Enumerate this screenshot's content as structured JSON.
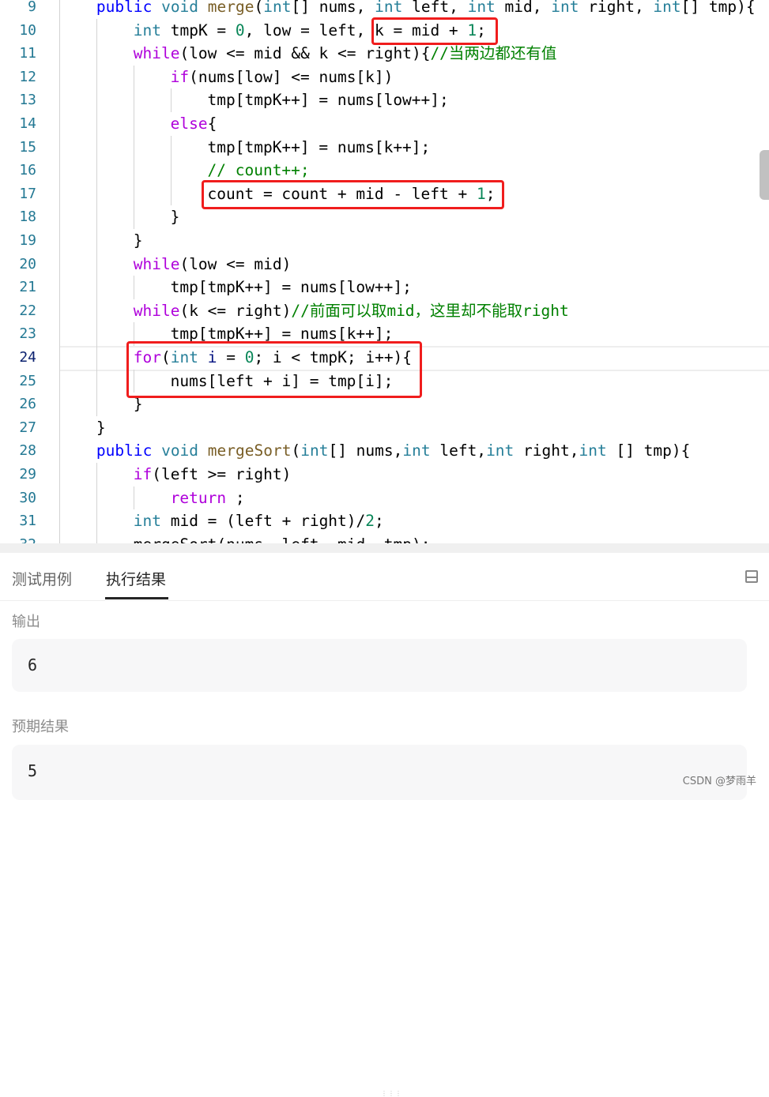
{
  "editor": {
    "active_line": 24,
    "lines": [
      {
        "n": "9",
        "indent": 1,
        "tokens": [
          [
            "public",
            "kw"
          ],
          [
            " ",
            ""
          ],
          [
            "void",
            "ty"
          ],
          [
            " ",
            ""
          ],
          [
            "merge",
            "fn"
          ],
          [
            "(",
            ""
          ],
          [
            "int",
            "ty"
          ],
          [
            "[] nums, ",
            ""
          ],
          [
            "int",
            "ty"
          ],
          [
            " left, ",
            ""
          ],
          [
            "int",
            "ty"
          ],
          [
            " mid, ",
            ""
          ],
          [
            "int",
            "ty"
          ],
          [
            " right, ",
            ""
          ],
          [
            "int",
            "ty"
          ],
          [
            "[] tmp){",
            ""
          ]
        ]
      },
      {
        "n": "10",
        "indent": 2,
        "tokens": [
          [
            "int",
            "ty"
          ],
          [
            " tmpK = ",
            ""
          ],
          [
            "0",
            "num"
          ],
          [
            ", low = left, k = mid + ",
            ""
          ],
          [
            "1",
            "num"
          ],
          [
            ";",
            ""
          ]
        ]
      },
      {
        "n": "11",
        "indent": 2,
        "tokens": [
          [
            "while",
            "ctl"
          ],
          [
            "(low <= mid && k <= right){",
            ""
          ],
          [
            "//当两边都还有值",
            "cm"
          ]
        ]
      },
      {
        "n": "12",
        "indent": 3,
        "tokens": [
          [
            "if",
            "ctl"
          ],
          [
            "(nums[low] <= nums[k])",
            ""
          ]
        ]
      },
      {
        "n": "13",
        "indent": 4,
        "tokens": [
          [
            "tmp[tmpK++] = nums[low++];",
            ""
          ]
        ]
      },
      {
        "n": "14",
        "indent": 3,
        "tokens": [
          [
            "else",
            "ctl"
          ],
          [
            "{",
            ""
          ]
        ]
      },
      {
        "n": "15",
        "indent": 4,
        "tokens": [
          [
            "tmp[tmpK++] = nums[k++];",
            ""
          ]
        ]
      },
      {
        "n": "16",
        "indent": 4,
        "tokens": [
          [
            "// count++;",
            "cm"
          ]
        ]
      },
      {
        "n": "17",
        "indent": 4,
        "tokens": [
          [
            "count = count + mid - left + ",
            ""
          ],
          [
            "1",
            "num"
          ],
          [
            ";",
            ""
          ]
        ]
      },
      {
        "n": "18",
        "indent": 3,
        "tokens": [
          [
            "}",
            ""
          ]
        ]
      },
      {
        "n": "19",
        "indent": 2,
        "tokens": [
          [
            "}",
            ""
          ]
        ]
      },
      {
        "n": "20",
        "indent": 2,
        "tokens": [
          [
            "while",
            "ctl"
          ],
          [
            "(low <= mid)",
            ""
          ]
        ]
      },
      {
        "n": "21",
        "indent": 3,
        "tokens": [
          [
            "tmp[tmpK++] = nums[low++];",
            ""
          ]
        ]
      },
      {
        "n": "22",
        "indent": 2,
        "tokens": [
          [
            "while",
            "ctl"
          ],
          [
            "(k <= right)",
            ""
          ],
          [
            "//前面可以取mid，这里却不能取right",
            "cm"
          ]
        ]
      },
      {
        "n": "23",
        "indent": 3,
        "tokens": [
          [
            "tmp[tmpK++] = nums[k++];",
            ""
          ]
        ]
      },
      {
        "n": "24",
        "indent": 2,
        "tokens": [
          [
            "for",
            "ctl"
          ],
          [
            "(",
            ""
          ],
          [
            "int",
            "ty"
          ],
          [
            " ",
            ""
          ],
          [
            "i",
            "var"
          ],
          [
            " = ",
            ""
          ],
          [
            "0",
            "num"
          ],
          [
            "; i < tmpK; i++){",
            ""
          ]
        ]
      },
      {
        "n": "25",
        "indent": 3,
        "tokens": [
          [
            "nums[left + i] = tmp[i];",
            ""
          ]
        ]
      },
      {
        "n": "26",
        "indent": 2,
        "tokens": [
          [
            "}",
            ""
          ]
        ]
      },
      {
        "n": "27",
        "indent": 1,
        "tokens": [
          [
            "}",
            ""
          ]
        ]
      },
      {
        "n": "28",
        "indent": 1,
        "tokens": [
          [
            "public",
            "kw"
          ],
          [
            " ",
            ""
          ],
          [
            "void",
            "ty"
          ],
          [
            " ",
            ""
          ],
          [
            "mergeSort",
            "fn"
          ],
          [
            "(",
            ""
          ],
          [
            "int",
            "ty"
          ],
          [
            "[] nums,",
            ""
          ],
          [
            "int",
            "ty"
          ],
          [
            " left,",
            ""
          ],
          [
            "int",
            "ty"
          ],
          [
            " right,",
            ""
          ],
          [
            "int",
            "ty"
          ],
          [
            " [] tmp){",
            ""
          ]
        ]
      },
      {
        "n": "29",
        "indent": 2,
        "tokens": [
          [
            "if",
            "ctl"
          ],
          [
            "(left >= right)",
            ""
          ]
        ]
      },
      {
        "n": "30",
        "indent": 3,
        "tokens": [
          [
            "return",
            "ctl"
          ],
          [
            " ;",
            ""
          ]
        ]
      },
      {
        "n": "31",
        "indent": 2,
        "tokens": [
          [
            "int",
            "ty"
          ],
          [
            " mid = (left + right)/",
            ""
          ],
          [
            "2",
            "num"
          ],
          [
            ";",
            ""
          ]
        ]
      },
      {
        "n": "32",
        "indent": 2,
        "tokens": [
          [
            "mergeSort(nums, left, mid, tmp);",
            ""
          ]
        ]
      }
    ]
  },
  "panel": {
    "tabs": [
      {
        "label": "测试用例"
      },
      {
        "label": "执行结果"
      }
    ],
    "active_tab": "执行结果",
    "output_label": "输出",
    "output_value": "6",
    "expected_label": "预期结果",
    "expected_value": "5"
  },
  "annotation_color": "#f01d1d",
  "watermark": "CSDN @梦雨羊"
}
